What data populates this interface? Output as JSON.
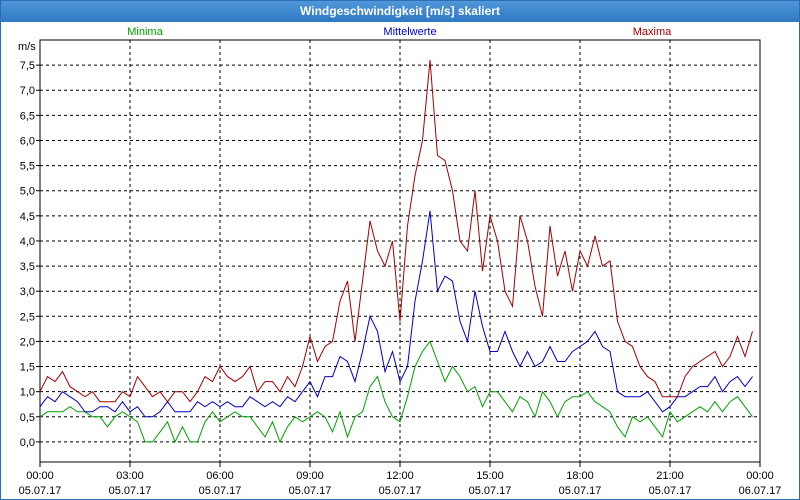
{
  "window": {
    "title": "Windgeschwindigkeit [m/s] skaliert"
  },
  "colors": {
    "min": "#00a000",
    "avg": "#0000c0",
    "max": "#a00000",
    "titlebar": "#3a86cf"
  },
  "chart_data": {
    "type": "line",
    "title": "Windgeschwindigkeit [m/s] skaliert",
    "ylabel": "m/s",
    "ylim": [
      -0.4,
      8.0
    ],
    "xlim": [
      0,
      24
    ],
    "grid": true,
    "legend_placement": "top",
    "yticks": [
      "0,0",
      "0,5",
      "1,0",
      "1,5",
      "2,0",
      "2,5",
      "3,0",
      "3,5",
      "4,0",
      "4,5",
      "5,0",
      "5,5",
      "6,0",
      "6,5",
      "7,0",
      "7,5"
    ],
    "ytick_values": [
      0,
      0.5,
      1,
      1.5,
      2,
      2.5,
      3,
      3.5,
      4,
      4.5,
      5,
      5.5,
      6,
      6.5,
      7,
      7.5
    ],
    "xticks": [
      {
        "time": "00:00",
        "date": "05.07.17",
        "h": 0
      },
      {
        "time": "03:00",
        "date": "05.07.17",
        "h": 3
      },
      {
        "time": "06:00",
        "date": "05.07.17",
        "h": 6
      },
      {
        "time": "09:00",
        "date": "05.07.17",
        "h": 9
      },
      {
        "time": "12:00",
        "date": "05.07.17",
        "h": 12
      },
      {
        "time": "15:00",
        "date": "05.07.17",
        "h": 15
      },
      {
        "time": "18:00",
        "date": "05.07.17",
        "h": 18
      },
      {
        "time": "21:00",
        "date": "05.07.17",
        "h": 21
      },
      {
        "time": "00:00",
        "date": "06.07.17",
        "h": 24
      }
    ],
    "x": [
      0,
      0.25,
      0.5,
      0.75,
      1,
      1.25,
      1.5,
      1.75,
      2,
      2.25,
      2.5,
      2.75,
      3,
      3.25,
      3.5,
      3.75,
      4,
      4.25,
      4.5,
      4.75,
      5,
      5.25,
      5.5,
      5.75,
      6,
      6.25,
      6.5,
      6.75,
      7,
      7.25,
      7.5,
      7.75,
      8,
      8.25,
      8.5,
      8.75,
      9,
      9.25,
      9.5,
      9.75,
      10,
      10.25,
      10.5,
      10.75,
      11,
      11.25,
      11.5,
      11.75,
      12,
      12.25,
      12.5,
      12.75,
      13,
      13.25,
      13.5,
      13.75,
      14,
      14.25,
      14.5,
      14.75,
      15,
      15.25,
      15.5,
      15.75,
      16,
      16.25,
      16.5,
      16.75,
      17,
      17.25,
      17.5,
      17.75,
      18,
      18.25,
      18.5,
      18.75,
      19,
      19.25,
      19.5,
      19.75,
      20,
      20.25,
      20.5,
      20.75,
      21,
      21.25,
      21.5,
      21.75,
      22,
      22.25,
      22.5,
      22.75,
      23,
      23.25,
      23.5,
      23.75,
      24
    ],
    "series": [
      {
        "name": "Minima",
        "color": "#00a000",
        "values": [
          0.5,
          0.6,
          0.6,
          0.6,
          0.7,
          0.6,
          0.6,
          0.5,
          0.5,
          0.3,
          0.5,
          0.6,
          0.5,
          0.4,
          0,
          0,
          0.2,
          0.4,
          0,
          0.3,
          0,
          0,
          0.4,
          0.6,
          0.4,
          0.5,
          0.6,
          0.5,
          0.5,
          0.3,
          0.1,
          0.4,
          0,
          0.3,
          0.5,
          0.4,
          0.5,
          0.6,
          0.5,
          0.2,
          0.6,
          0.1,
          0.5,
          0.6,
          1.1,
          1.3,
          0.8,
          0.5,
          0.4,
          0.9,
          1.5,
          1.8,
          2.0,
          1.6,
          1.2,
          1.5,
          1.3,
          1.0,
          1.1,
          0.7,
          1.0,
          1.0,
          0.8,
          0.6,
          0.9,
          0.8,
          0.5,
          1.0,
          0.8,
          0.5,
          0.8,
          0.9,
          0.9,
          1.0,
          0.8,
          0.7,
          0.6,
          0.3,
          0.1,
          0.5,
          0.4,
          0.5,
          0.3,
          0.1,
          0.6,
          0.4,
          0.5,
          0.6,
          0.7,
          0.6,
          0.8,
          0.6,
          0.8,
          0.9,
          0.7,
          0.5
        ]
      },
      {
        "name": "Mittelwerte",
        "color": "#0000c0",
        "values": [
          0.7,
          0.9,
          0.8,
          1.0,
          0.9,
          0.8,
          0.6,
          0.6,
          0.7,
          0.7,
          0.6,
          0.8,
          0.6,
          0.7,
          0.5,
          0.5,
          0.6,
          0.8,
          0.6,
          0.6,
          0.6,
          0.8,
          0.7,
          0.8,
          0.7,
          0.8,
          0.7,
          0.7,
          0.9,
          0.8,
          0.7,
          0.8,
          0.7,
          0.9,
          0.8,
          1.0,
          1.2,
          0.9,
          1.3,
          1.3,
          1.7,
          1.6,
          1.2,
          1.8,
          2.5,
          2.2,
          1.4,
          1.8,
          1.2,
          1.5,
          2.8,
          3.6,
          4.6,
          3.0,
          3.3,
          3.2,
          2.4,
          2.0,
          3.0,
          2.3,
          1.8,
          1.8,
          2.2,
          1.8,
          1.5,
          1.8,
          1.5,
          1.6,
          1.9,
          1.6,
          1.6,
          1.8,
          1.9,
          2.0,
          2.2,
          1.9,
          1.8,
          1.0,
          0.9,
          0.9,
          0.9,
          1.0,
          0.8,
          0.6,
          0.7,
          0.9,
          0.9,
          1.0,
          1.1,
          1.1,
          1.3,
          1.0,
          1.2,
          1.3,
          1.1,
          1.3
        ]
      },
      {
        "name": "Maxima",
        "color": "#a00000",
        "values": [
          1.0,
          1.3,
          1.2,
          1.4,
          1.1,
          1.0,
          0.9,
          1.0,
          0.8,
          0.8,
          0.8,
          1.0,
          0.9,
          1.3,
          1.1,
          0.9,
          1.0,
          0.8,
          1.0,
          1.0,
          0.8,
          1.0,
          1.3,
          1.2,
          1.5,
          1.3,
          1.2,
          1.3,
          1.5,
          1.0,
          1.2,
          1.2,
          1.0,
          1.3,
          1.1,
          1.5,
          2.1,
          1.6,
          1.9,
          2.0,
          2.8,
          3.2,
          2.0,
          3.2,
          4.4,
          3.8,
          3.5,
          4.0,
          2.4,
          4.3,
          5.3,
          6.0,
          7.6,
          5.7,
          5.6,
          5.0,
          4.0,
          3.8,
          5.0,
          3.4,
          4.5,
          4.0,
          3.0,
          2.7,
          4.5,
          4.0,
          3.1,
          2.5,
          4.3,
          3.3,
          3.8,
          3.0,
          3.8,
          3.5,
          4.1,
          3.5,
          3.6,
          2.4,
          2.0,
          1.9,
          1.5,
          1.3,
          1.2,
          0.9,
          0.9,
          0.9,
          1.3,
          1.5,
          1.6,
          1.7,
          1.8,
          1.5,
          1.7,
          2.1,
          1.7,
          2.2
        ]
      }
    ]
  }
}
